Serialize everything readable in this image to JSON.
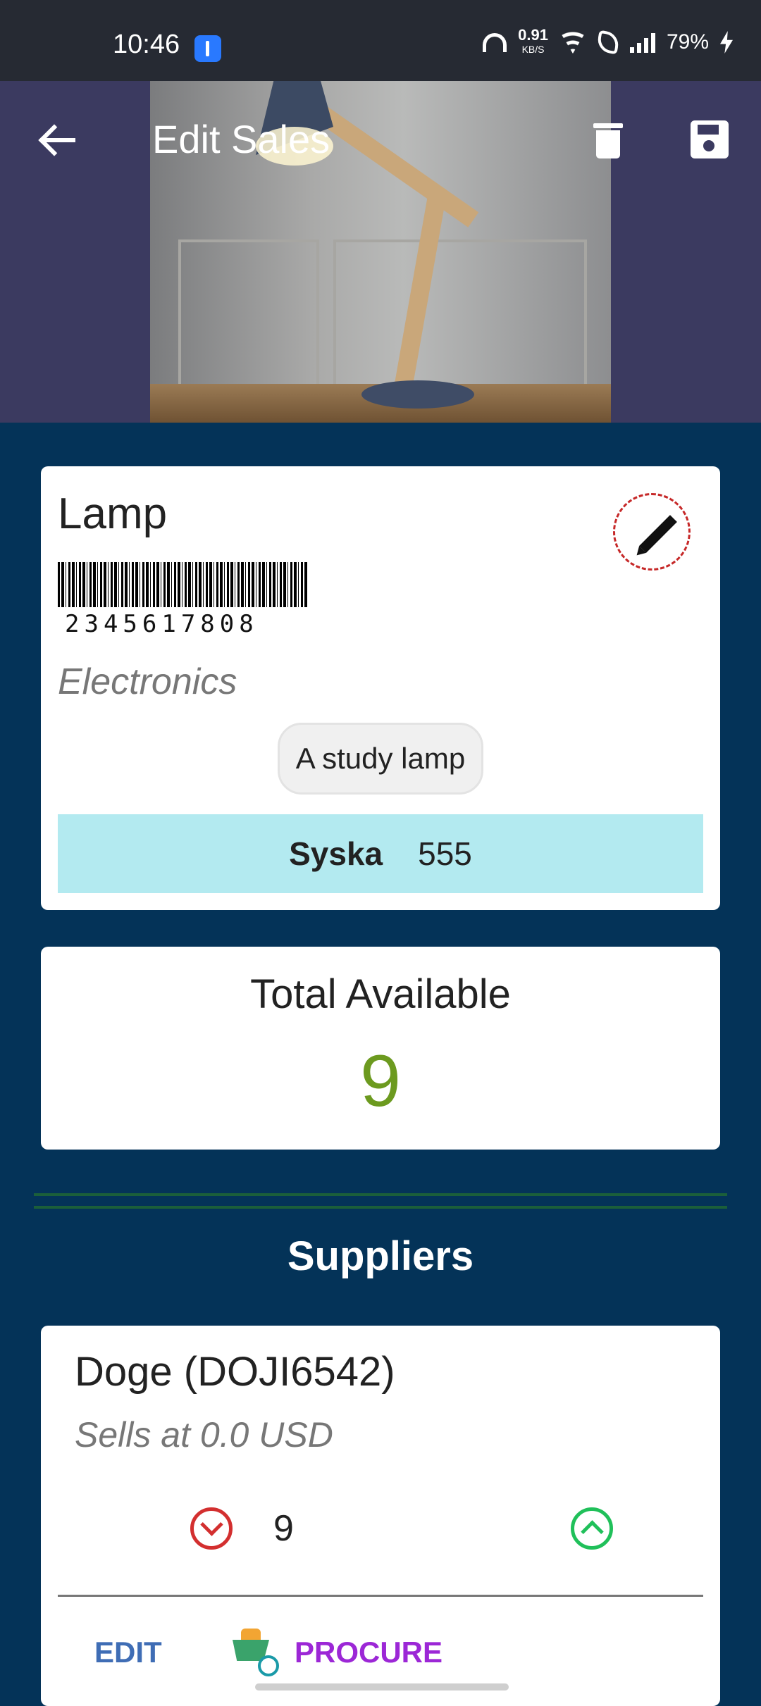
{
  "status_bar": {
    "time": "10:46",
    "net_speed_value": "0.91",
    "net_speed_unit": "KB/S",
    "battery": "79%"
  },
  "app_bar": {
    "title": "Edit Sales",
    "icons": [
      "back-arrow-icon",
      "delete-icon",
      "save-icon"
    ]
  },
  "product": {
    "name": "Lamp",
    "barcode": "2345617808",
    "category": "Electronics",
    "description": "A study lamp",
    "brand": "Syska",
    "brand_value": "555"
  },
  "total": {
    "label": "Total Available",
    "value": "9"
  },
  "suppliers": {
    "title": "Suppliers",
    "items": [
      {
        "name": "Doge (DOJI6542)",
        "price_text": "Sells at 0.0 USD",
        "quantity": "9",
        "edit_label": "EDIT",
        "procure_label": "PROCURE"
      }
    ]
  },
  "colors": {
    "background": "#043358",
    "header": "#3b3a60",
    "brand_strip": "#b3eaf0",
    "total_value": "#6c9a1f",
    "decrement": "#d32f2f",
    "increment": "#20c05a",
    "edit_link": "#3f6db5",
    "procure_link": "#9c27d6"
  }
}
